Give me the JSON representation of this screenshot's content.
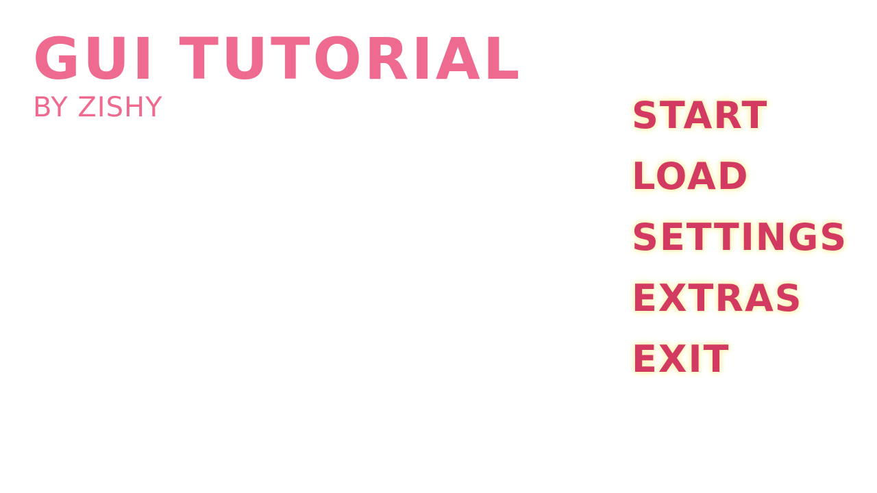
{
  "title": {
    "name": "GUI TUTORIAL",
    "byline": "BY ZISHY"
  },
  "menu": {
    "items": [
      {
        "label": "START"
      },
      {
        "label": "LOAD"
      },
      {
        "label": "SETTINGS"
      },
      {
        "label": "EXTRAS"
      },
      {
        "label": "EXIT"
      }
    ]
  },
  "colors": {
    "background": "#ffffff",
    "title": "#ee6a8f",
    "menu_text": "#d23a62",
    "menu_glow": "#fff3b8"
  }
}
